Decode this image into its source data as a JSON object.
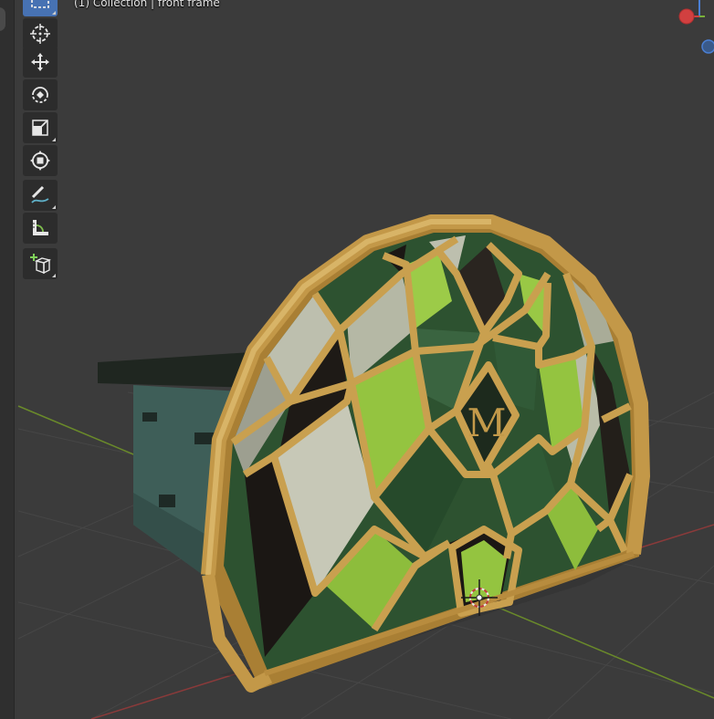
{
  "viewport": {
    "header_text": "(1) Collection | front frame",
    "logo_letter": "M"
  },
  "tools": [
    {
      "name": "select-box",
      "icon": "select-box-icon",
      "active": true
    },
    {
      "name": "cursor",
      "icon": "cursor-icon"
    },
    {
      "name": "move",
      "icon": "move-icon"
    },
    {
      "name": "rotate",
      "icon": "rotate-icon"
    },
    {
      "name": "scale",
      "icon": "scale-icon"
    },
    {
      "name": "transform",
      "icon": "transform-icon"
    },
    {
      "name": "annotate",
      "icon": "annotate-icon"
    },
    {
      "name": "measure",
      "icon": "measure-icon"
    },
    {
      "name": "add-cube",
      "icon": "add-cube-icon"
    }
  ],
  "colors": {
    "background": "#3b3b3b",
    "grid": "#454545",
    "x_axis": "#8a3a3a",
    "y_axis": "#6a8a2a",
    "frame_gold": "#c9a04f",
    "glass_light_green": "#94c440",
    "glass_dark_green": "#2d5230",
    "glass_pale": "#bdbfae",
    "glass_black": "#1b1714",
    "wall_teal": "#3e5e58",
    "active_tool": "#4772b3"
  }
}
